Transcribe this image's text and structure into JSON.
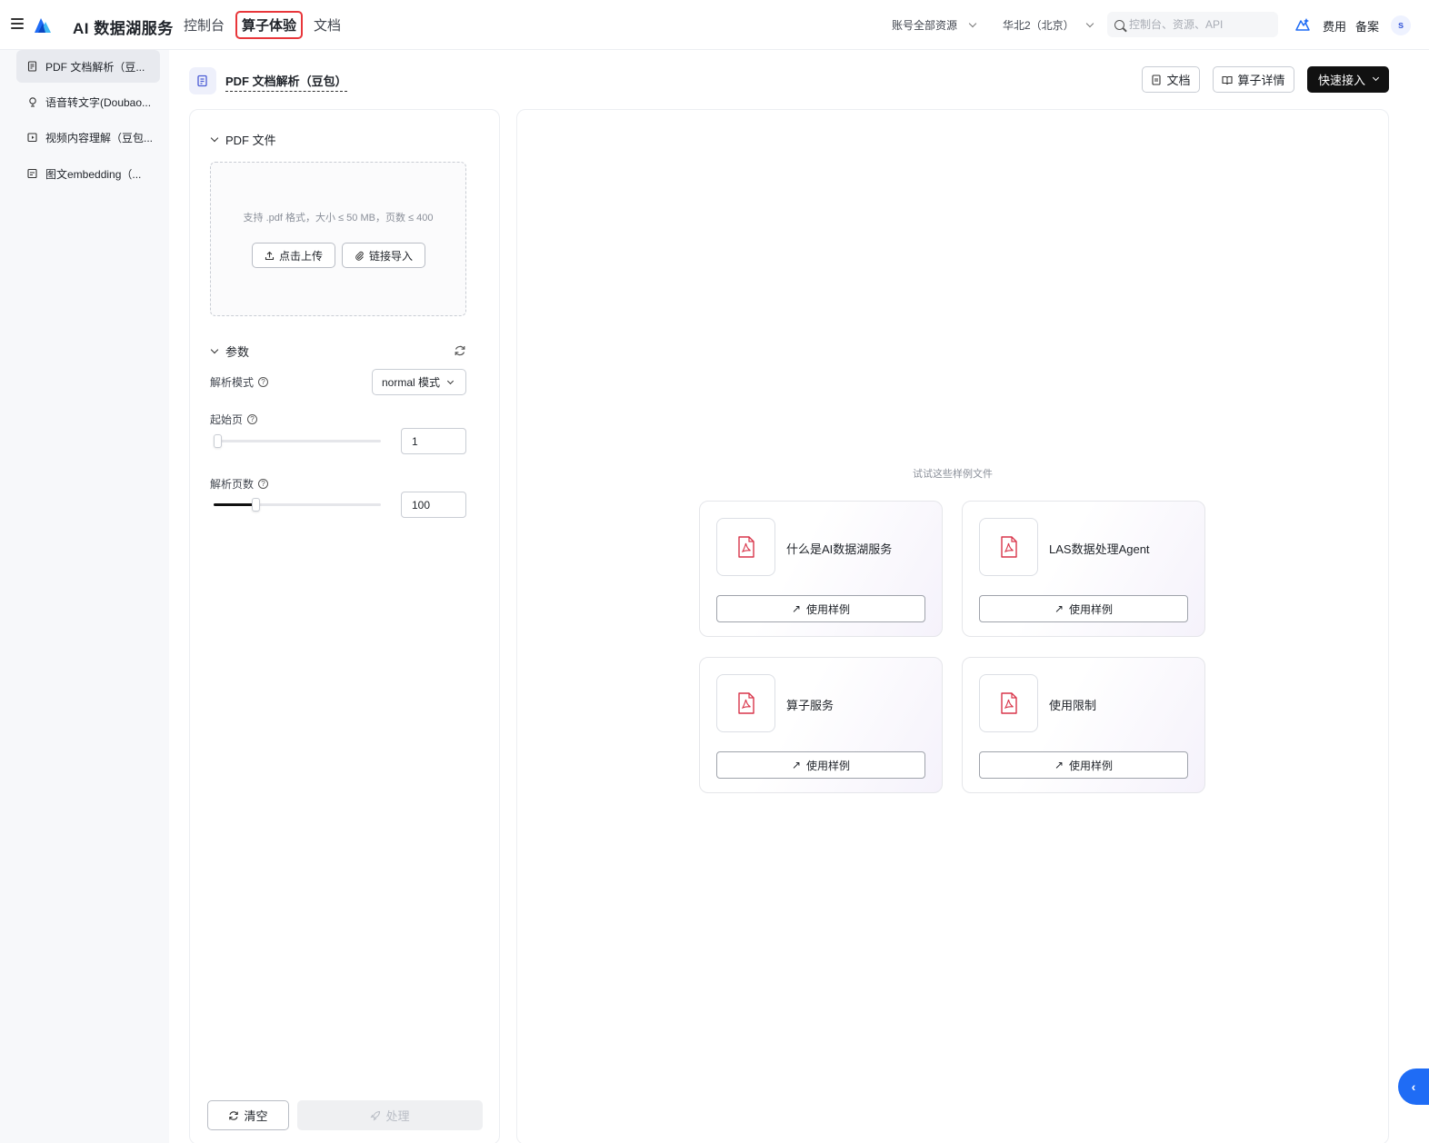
{
  "header": {
    "app_title": "AI 数据湖服务",
    "nav_tabs": [
      {
        "label": "控制台"
      },
      {
        "label": "算子体验"
      },
      {
        "label": "文档"
      }
    ],
    "account_scope": "账号全部资源",
    "region": "华北2（北京）",
    "search_placeholder": "控制台、资源、API",
    "cost_label": "费用",
    "filing_label": "备案",
    "avatar_initial": "s"
  },
  "sidebar": {
    "items": [
      {
        "label": "PDF 文档解析（豆..."
      },
      {
        "label": "语音转文字(Doubao..."
      },
      {
        "label": "视频内容理解（豆包..."
      },
      {
        "label": "图文embedding（..."
      }
    ]
  },
  "page": {
    "title": "PDF 文档解析（豆包）",
    "doc_button": "文档",
    "detail_button": "算子详情",
    "quick_access_button": "快速接入"
  },
  "left_panel": {
    "file_section_title": "PDF 文件",
    "upload_hint": "支持 .pdf 格式，大小 ≤ 50 MB，页数 ≤ 400",
    "upload_button": "点击上传",
    "link_import_button": "链接导入",
    "params_section_title": "参数",
    "parse_mode_label": "解析模式",
    "parse_mode_value": "normal 模式",
    "start_page_label": "起始页",
    "start_page_value": "1",
    "start_page_slider_fraction": 0.0,
    "page_count_label": "解析页数",
    "page_count_value": "100",
    "page_count_slider_fraction": 0.25,
    "clear_button": "清空",
    "process_button": "处理"
  },
  "right_panel": {
    "samples_hint": "试试这些样例文件",
    "samples": [
      {
        "name": "什么是AI数据湖服务",
        "button": "使用样例"
      },
      {
        "name": "LAS数据处理Agent",
        "button": "使用样例"
      },
      {
        "name": "算子服务",
        "button": "使用样例"
      },
      {
        "name": "使用限制",
        "button": "使用样例"
      }
    ]
  },
  "colors": {
    "highlight_border": "#e8363a",
    "primary_dark": "#111111",
    "pdf_icon_red": "#d9354a",
    "toggle_blue": "#1f6cf5"
  }
}
